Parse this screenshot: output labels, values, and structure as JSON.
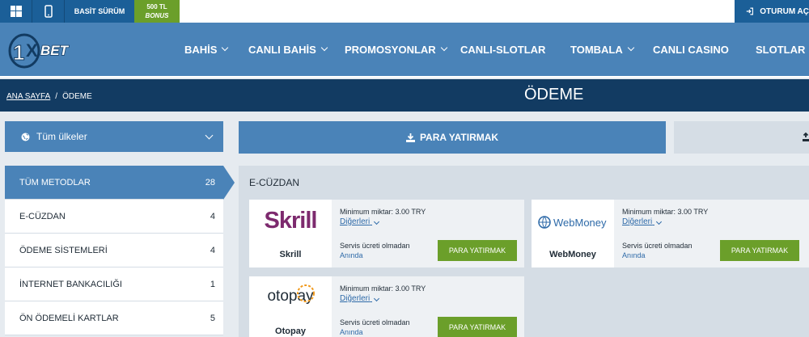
{
  "topbar": {
    "windows_icon": "windows-icon",
    "mobile_icon": "mobile-icon",
    "basit_label": "BASİT SÜRÜM",
    "bonus_line1": "500 TL",
    "bonus_line2": "BONUS",
    "login_label": "OTURUM AÇ"
  },
  "header": {
    "logo_text": "1XBET",
    "nav": [
      {
        "label": "BAHİS",
        "dropdown": true
      },
      {
        "label": "CANLI BAHİS",
        "dropdown": true
      },
      {
        "label": "PROMOSYONLAR",
        "dropdown": true
      },
      {
        "label": "CANLI-SLOTLAR",
        "dropdown": false
      },
      {
        "label": "TOMBALA",
        "dropdown": true
      },
      {
        "label": "CANLI CASINO",
        "dropdown": false
      },
      {
        "label": "SLOTLAR",
        "dropdown": false
      }
    ]
  },
  "breadcrumb": {
    "home": "ANA SAYFA",
    "separator": "/",
    "current": "ÖDEME"
  },
  "page_title": "ÖDEME",
  "country_select": {
    "value": "Tüm ülkeler"
  },
  "methods": [
    {
      "label": "TÜM METODLAR",
      "count": "28",
      "active": true
    },
    {
      "label": "E-CÜZDAN",
      "count": "4",
      "active": false
    },
    {
      "label": "ÖDEME SİSTEMLERİ",
      "count": "4",
      "active": false
    },
    {
      "label": "İNTERNET BANKACILIĞI",
      "count": "1",
      "active": false
    },
    {
      "label": "ÖN ÖDEMELİ KARTLAR",
      "count": "5",
      "active": false
    }
  ],
  "tabs": {
    "deposit": "PARA YATIRMAK"
  },
  "section": {
    "title": "E-CÜZDAN"
  },
  "cards": [
    {
      "name": "Skrill",
      "logo_text": "Skrill",
      "min": "Minimum miktar: 3.00 TRY",
      "more": "Diğerleri",
      "fee": "Servis ücreti olmadan",
      "time": "Anında",
      "button": "PARA YATIRMAK"
    },
    {
      "name": "WebMoney",
      "logo_text": "WebMoney",
      "min": "Minimum miktar: 3.00 TRY",
      "more": "Diğerleri",
      "fee": "Servis ücreti olmadan",
      "time": "Anında",
      "button": "PARA YATIRMAK"
    },
    {
      "name": "Otopay",
      "logo_text": "otopay",
      "min": "Minimum miktar: 3.00 TRY",
      "more": "Diğerleri",
      "fee": "Servis ücreti olmadan",
      "time": "Anında",
      "button": "PARA YATIRMAK"
    }
  ],
  "colors": {
    "primary": "#4a83b8",
    "dark": "#123b62",
    "accent_green": "#6b9f2a",
    "skrill": "#7d2a6e",
    "webmoney": "#2e6aa8",
    "otopay_orange": "#f19a1d"
  }
}
